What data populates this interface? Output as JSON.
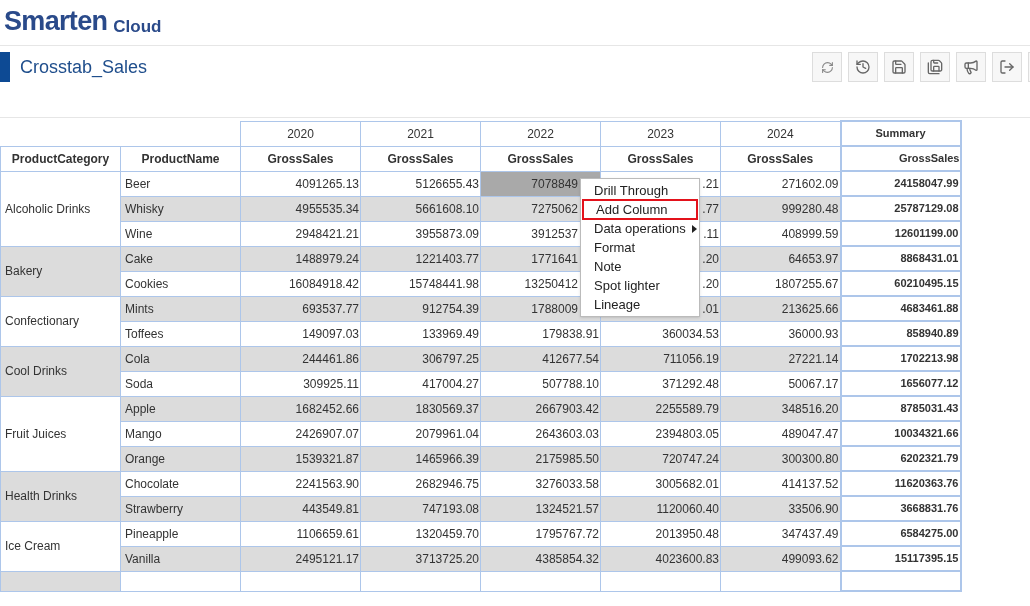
{
  "brand": {
    "name": "Smarten",
    "suffix": "Cloud"
  },
  "report": {
    "title": "Crosstab_Sales"
  },
  "toolbar": [
    {
      "kind": "refresh"
    },
    {
      "kind": "history"
    },
    {
      "kind": "save"
    },
    {
      "kind": "save-as"
    },
    {
      "kind": "announce"
    },
    {
      "kind": "exit"
    },
    {
      "kind": "partial"
    }
  ],
  "table": {
    "years": [
      "2020",
      "2021",
      "2022",
      "2023",
      "2024"
    ],
    "summary_label": "Summary",
    "row_headers": [
      "ProductCategory",
      "ProductName"
    ],
    "measures": [
      "GrossSales",
      "GrossSales",
      "GrossSales",
      "GrossSales",
      "GrossSales"
    ],
    "summary_measure": "GrossSales",
    "groups": [
      {
        "category": "Alcoholic Drinks",
        "products": [
          {
            "name": "Beer",
            "cells": [
              {
                "text": "4091265.13",
                "selected": false
              },
              {
                "text": "5126655.43",
                "selected": false
              },
              {
                "text": "7078849",
                "selected": true
              },
              {
                "text": ".21",
                "selected": false
              },
              {
                "text": "271602.09",
                "selected": false
              }
            ],
            "summary": "24158047.99"
          },
          {
            "name": "Whisky",
            "cells": [
              {
                "text": "4955535.34",
                "selected": false
              },
              {
                "text": "5661608.10",
                "selected": false
              },
              {
                "text": "7275062",
                "selected": false
              },
              {
                "text": ".77",
                "selected": false
              },
              {
                "text": "999280.48",
                "selected": false
              }
            ],
            "summary": "25787129.08"
          },
          {
            "name": "Wine",
            "cells": [
              {
                "text": "2948421.21",
                "selected": false
              },
              {
                "text": "3955873.09",
                "selected": false
              },
              {
                "text": "3912537",
                "selected": false
              },
              {
                "text": ".11",
                "selected": false
              },
              {
                "text": "408999.59",
                "selected": false
              }
            ],
            "summary": "12601199.00"
          }
        ]
      },
      {
        "category": "Bakery",
        "products": [
          {
            "name": "Cake",
            "cells": [
              {
                "text": "1488979.24",
                "selected": false
              },
              {
                "text": "1221403.77",
                "selected": false
              },
              {
                "text": "1771641",
                "selected": false
              },
              {
                "text": ".20",
                "selected": false
              },
              {
                "text": "64653.97",
                "selected": false
              }
            ],
            "summary": "8868431.01"
          },
          {
            "name": "Cookies",
            "cells": [
              {
                "text": "16084918.42",
                "selected": false
              },
              {
                "text": "15748441.98",
                "selected": false
              },
              {
                "text": "13250412",
                "selected": false
              },
              {
                "text": ".20",
                "selected": false
              },
              {
                "text": "1807255.67",
                "selected": false
              }
            ],
            "summary": "60210495.15"
          }
        ]
      },
      {
        "category": "Confectionary",
        "products": [
          {
            "name": "Mints",
            "cells": [
              {
                "text": "693537.77",
                "selected": false
              },
              {
                "text": "912754.39",
                "selected": false
              },
              {
                "text": "1788009",
                "selected": false
              },
              {
                "text": ".01",
                "selected": false
              },
              {
                "text": "213625.66",
                "selected": false
              }
            ],
            "summary": "4683461.88"
          },
          {
            "name": "Toffees",
            "cells": [
              {
                "text": "149097.03",
                "selected": false
              },
              {
                "text": "133969.49",
                "selected": false
              },
              {
                "text": "179838.91",
                "selected": false
              },
              {
                "text": "360034.53",
                "selected": false
              },
              {
                "text": "36000.93",
                "selected": false
              }
            ],
            "summary": "858940.89"
          }
        ]
      },
      {
        "category": "Cool Drinks",
        "products": [
          {
            "name": "Cola",
            "cells": [
              {
                "text": "244461.86",
                "selected": false
              },
              {
                "text": "306797.25",
                "selected": false
              },
              {
                "text": "412677.54",
                "selected": false
              },
              {
                "text": "711056.19",
                "selected": false
              },
              {
                "text": "27221.14",
                "selected": false
              }
            ],
            "summary": "1702213.98"
          },
          {
            "name": "Soda",
            "cells": [
              {
                "text": "309925.11",
                "selected": false
              },
              {
                "text": "417004.27",
                "selected": false
              },
              {
                "text": "507788.10",
                "selected": false
              },
              {
                "text": "371292.48",
                "selected": false
              },
              {
                "text": "50067.17",
                "selected": false
              }
            ],
            "summary": "1656077.12"
          }
        ]
      },
      {
        "category": "Fruit Juices",
        "products": [
          {
            "name": "Apple",
            "cells": [
              {
                "text": "1682452.66",
                "selected": false
              },
              {
                "text": "1830569.37",
                "selected": false
              },
              {
                "text": "2667903.42",
                "selected": false
              },
              {
                "text": "2255589.79",
                "selected": false
              },
              {
                "text": "348516.20",
                "selected": false
              }
            ],
            "summary": "8785031.43"
          },
          {
            "name": "Mango",
            "cells": [
              {
                "text": "2426907.07",
                "selected": false
              },
              {
                "text": "2079961.04",
                "selected": false
              },
              {
                "text": "2643603.03",
                "selected": false
              },
              {
                "text": "2394803.05",
                "selected": false
              },
              {
                "text": "489047.47",
                "selected": false
              }
            ],
            "summary": "10034321.66"
          },
          {
            "name": "Orange",
            "cells": [
              {
                "text": "1539321.87",
                "selected": false
              },
              {
                "text": "1465966.39",
                "selected": false
              },
              {
                "text": "2175985.50",
                "selected": false
              },
              {
                "text": "720747.24",
                "selected": false
              },
              {
                "text": "300300.80",
                "selected": false
              }
            ],
            "summary": "6202321.79"
          }
        ]
      },
      {
        "category": "Health Drinks",
        "products": [
          {
            "name": "Chocolate",
            "cells": [
              {
                "text": "2241563.90",
                "selected": false
              },
              {
                "text": "2682946.75",
                "selected": false
              },
              {
                "text": "3276033.58",
                "selected": false
              },
              {
                "text": "3005682.01",
                "selected": false
              },
              {
                "text": "414137.52",
                "selected": false
              }
            ],
            "summary": "11620363.76"
          },
          {
            "name": "Strawberry",
            "cells": [
              {
                "text": "443549.81",
                "selected": false
              },
              {
                "text": "747193.08",
                "selected": false
              },
              {
                "text": "1324521.57",
                "selected": false
              },
              {
                "text": "1120060.40",
                "selected": false
              },
              {
                "text": "33506.90",
                "selected": false
              }
            ],
            "summary": "3668831.76"
          }
        ]
      },
      {
        "category": "Ice Cream",
        "products": [
          {
            "name": "Pineapple",
            "cells": [
              {
                "text": "1106659.61",
                "selected": false
              },
              {
                "text": "1320459.70",
                "selected": false
              },
              {
                "text": "1795767.72",
                "selected": false
              },
              {
                "text": "2013950.48",
                "selected": false
              },
              {
                "text": "347437.49",
                "selected": false
              }
            ],
            "summary": "6584275.00"
          },
          {
            "name": "Vanilla",
            "cells": [
              {
                "text": "2495121.17",
                "selected": false
              },
              {
                "text": "3713725.20",
                "selected": false
              },
              {
                "text": "4385854.32",
                "selected": false
              },
              {
                "text": "4023600.83",
                "selected": false
              },
              {
                "text": "499093.62",
                "selected": false
              }
            ],
            "summary": "15117395.15"
          }
        ]
      }
    ]
  },
  "context_menu": {
    "items": [
      {
        "label": "Drill Through",
        "kind": "plain",
        "highlighted": false
      },
      {
        "label": "Add Column",
        "kind": "plain",
        "highlighted": true
      },
      {
        "label": "Data operations",
        "kind": "submenu",
        "highlighted": false
      },
      {
        "label": "Format",
        "kind": "plain",
        "highlighted": false
      },
      {
        "label": "Note",
        "kind": "plain",
        "highlighted": false
      },
      {
        "label": "Spot lighter",
        "kind": "plain",
        "highlighted": false
      },
      {
        "label": "Lineage",
        "kind": "plain",
        "highlighted": false
      }
    ]
  }
}
